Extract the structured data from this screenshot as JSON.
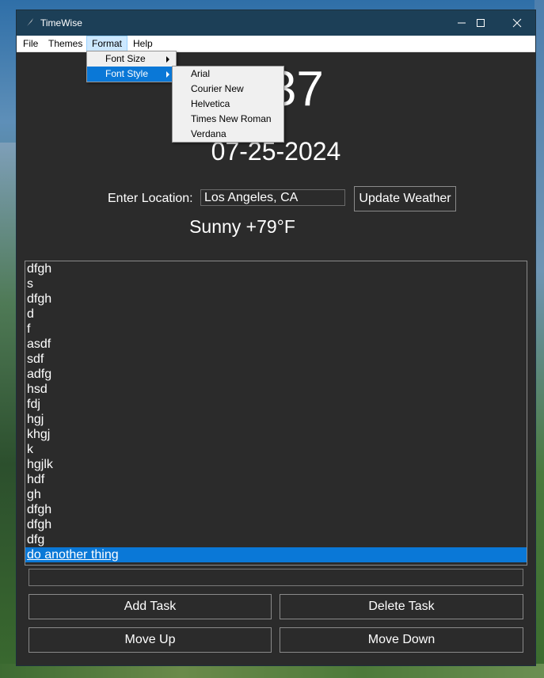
{
  "window": {
    "title": "TimeWise"
  },
  "menubar": [
    "File",
    "Themes",
    "Format",
    "Help"
  ],
  "format_menu": [
    {
      "label": "Font Size"
    },
    {
      "label": "Font Style"
    }
  ],
  "font_style_menu": [
    "Arial",
    "Courier New",
    "Helvetica",
    "Times New Roman",
    "Verdana"
  ],
  "clock": {
    "time": "6:37",
    "date": "07-25-2024"
  },
  "location": {
    "label": "Enter Location:",
    "value": "Los Angeles, CA",
    "button": "Update Weather"
  },
  "weather": {
    "text": "Sunny +79°F"
  },
  "tasks": {
    "items": [
      "dfgh",
      "s",
      "dfgh",
      "d",
      "f",
      "asdf",
      "sdf",
      "adfg",
      "hsd",
      "fdj",
      "hgj",
      "khgj",
      "k",
      "hgjlk",
      "hdf",
      "gh",
      "dfgh",
      "dfgh",
      "dfg",
      "do another thing"
    ],
    "selected": "do another thing",
    "entry_value": ""
  },
  "buttons": {
    "add": "Add Task",
    "delete": "Delete Task",
    "up": "Move Up",
    "down": "Move Down"
  },
  "colors": {
    "titlebar": "#1c3f57",
    "background": "#2b2b2b",
    "selection": "#0a78d7"
  }
}
